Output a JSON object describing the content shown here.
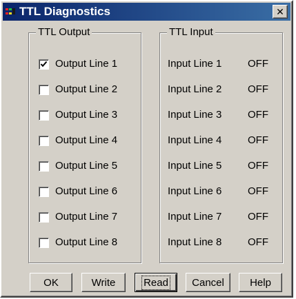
{
  "window": {
    "title": "TTL Diagnostics",
    "close_glyph": "✕"
  },
  "output_group": {
    "label": "TTL Output",
    "lines": [
      {
        "label": "Output Line 1",
        "checked": true
      },
      {
        "label": "Output Line 2",
        "checked": false
      },
      {
        "label": "Output Line 3",
        "checked": false
      },
      {
        "label": "Output Line 4",
        "checked": false
      },
      {
        "label": "Output Line 5",
        "checked": false
      },
      {
        "label": "Output Line 6",
        "checked": false
      },
      {
        "label": "Output Line 7",
        "checked": false
      },
      {
        "label": "Output Line 8",
        "checked": false
      }
    ]
  },
  "input_group": {
    "label": "TTL Input",
    "lines": [
      {
        "label": "Input Line 1",
        "status": "OFF"
      },
      {
        "label": "Input Line 2",
        "status": "OFF"
      },
      {
        "label": "Input Line 3",
        "status": "OFF"
      },
      {
        "label": "Input Line 4",
        "status": "OFF"
      },
      {
        "label": "Input Line 5",
        "status": "OFF"
      },
      {
        "label": "Input Line 6",
        "status": "OFF"
      },
      {
        "label": "Input Line 7",
        "status": "OFF"
      },
      {
        "label": "Input Line 8",
        "status": "OFF"
      }
    ]
  },
  "buttons": {
    "ok": "OK",
    "write": "Write",
    "read": "Read",
    "cancel": "Cancel",
    "help": "Help"
  },
  "icons": {
    "app": "ttl-app-icon",
    "close": "close-icon",
    "check": "checkmark-icon"
  },
  "colors": {
    "titlebar_start": "#0a246a",
    "titlebar_end": "#3a6ea5",
    "face": "#d4d0c8"
  }
}
